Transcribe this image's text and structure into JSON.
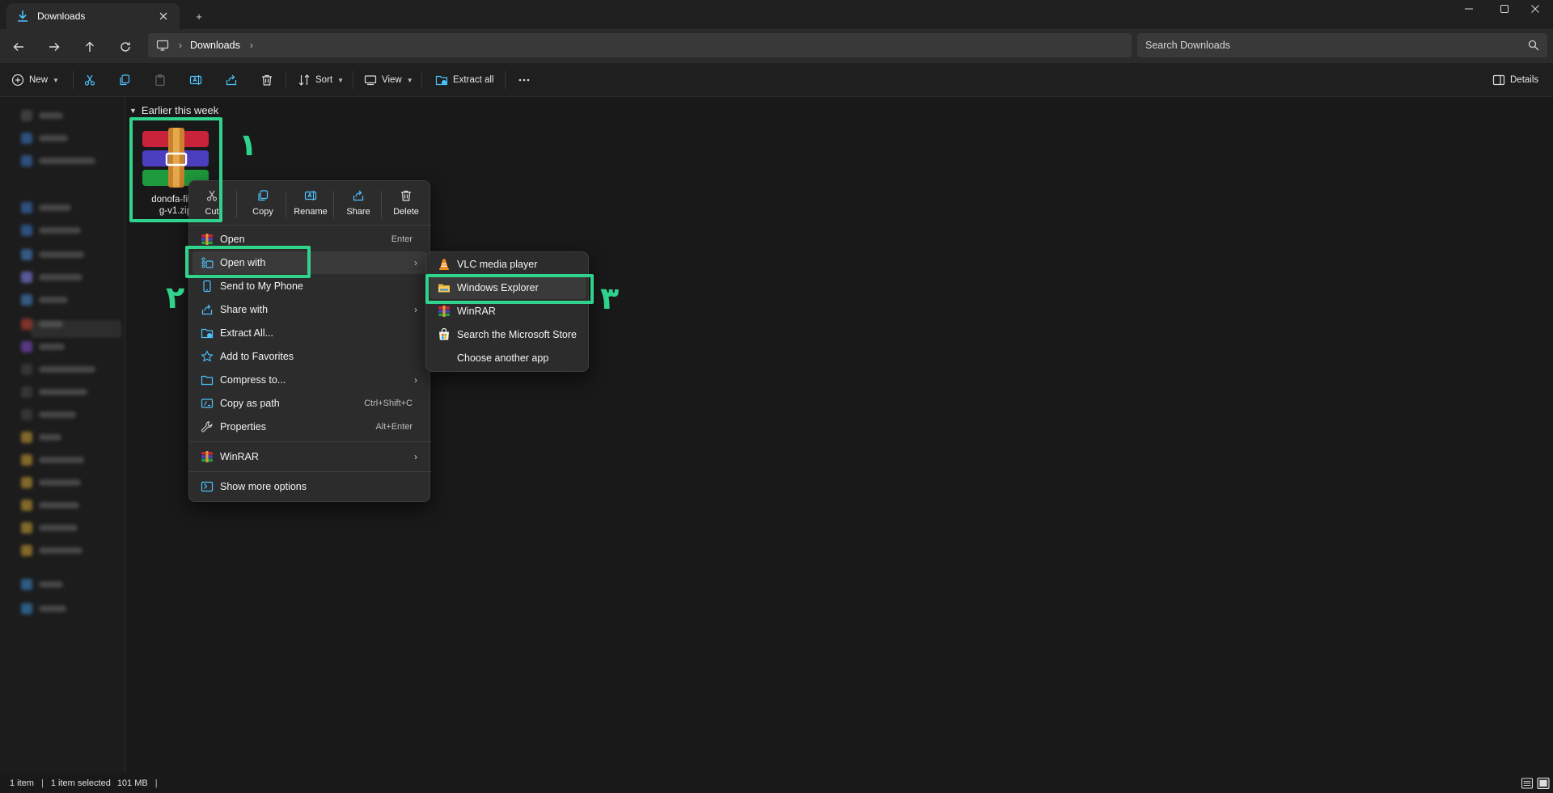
{
  "window": {
    "tab_title": "Downloads",
    "tab_icon": "download-icon",
    "new_tab_glyph": "+",
    "controls": [
      "minimize-icon",
      "maximize-icon",
      "close-icon"
    ]
  },
  "address_bar": {
    "breadcrumb": [
      "Downloads"
    ],
    "search_placeholder": "Search Downloads"
  },
  "toolbar": {
    "new_label": "New",
    "sort_label": "Sort",
    "view_label": "View",
    "extract_all_label": "Extract all",
    "details_label": "Details"
  },
  "content": {
    "group_header": "Earlier this week",
    "file": {
      "name_line1": "donofa-files",
      "name_line2": "g-v1.zip"
    }
  },
  "context_menu": {
    "quick_actions": [
      {
        "label": "Cut",
        "icon": "scissors-icon"
      },
      {
        "label": "Copy",
        "icon": "copy-icon"
      },
      {
        "label": "Rename",
        "icon": "rename-icon"
      },
      {
        "label": "Share",
        "icon": "share-icon"
      },
      {
        "label": "Delete",
        "icon": "trash-icon"
      }
    ],
    "items": [
      {
        "label": "Open",
        "shortcut": "Enter",
        "icon": "winrar-icon"
      },
      {
        "label": "Open with",
        "shortcut": "",
        "icon": "open-with-icon",
        "submenu": true
      },
      {
        "label": "Send to My Phone",
        "shortcut": "",
        "icon": "phone-icon"
      },
      {
        "label": "Share with",
        "shortcut": "",
        "icon": "share-icon",
        "submenu": true
      },
      {
        "label": "Extract All...",
        "shortcut": "",
        "icon": "extract-icon"
      },
      {
        "label": "Add to Favorites",
        "shortcut": "",
        "icon": "star-icon"
      },
      {
        "label": "Compress to...",
        "shortcut": "",
        "icon": "folder-zip-icon",
        "submenu": true
      },
      {
        "label": "Copy as path",
        "shortcut": "Ctrl+Shift+C",
        "icon": "path-icon"
      },
      {
        "label": "Properties",
        "shortcut": "Alt+Enter",
        "icon": "wrench-icon"
      },
      {
        "label": "WinRAR",
        "shortcut": "",
        "icon": "winrar-icon",
        "submenu": true
      },
      {
        "label": "Show more options",
        "shortcut": "",
        "icon": "more-options-icon"
      }
    ]
  },
  "submenu": {
    "items": [
      {
        "label": "VLC media player",
        "icon": "vlc-icon"
      },
      {
        "label": "Windows Explorer",
        "icon": "folder-icon"
      },
      {
        "label": "WinRAR",
        "icon": "winrar-icon"
      },
      {
        "label": "Search the Microsoft Store",
        "icon": "store-icon"
      },
      {
        "label": "Choose another app",
        "icon": ""
      }
    ]
  },
  "annotations": {
    "step1": "١",
    "step2": "٢",
    "step3": "٣",
    "highlight_color": "#2fd38b"
  },
  "status_bar": {
    "item_count": "1 item",
    "selected": "1 item selected",
    "size": "101 MB"
  },
  "colors": {
    "accent": "#4cc2ff",
    "background": "#191919",
    "menu": "#2c2c2c"
  }
}
